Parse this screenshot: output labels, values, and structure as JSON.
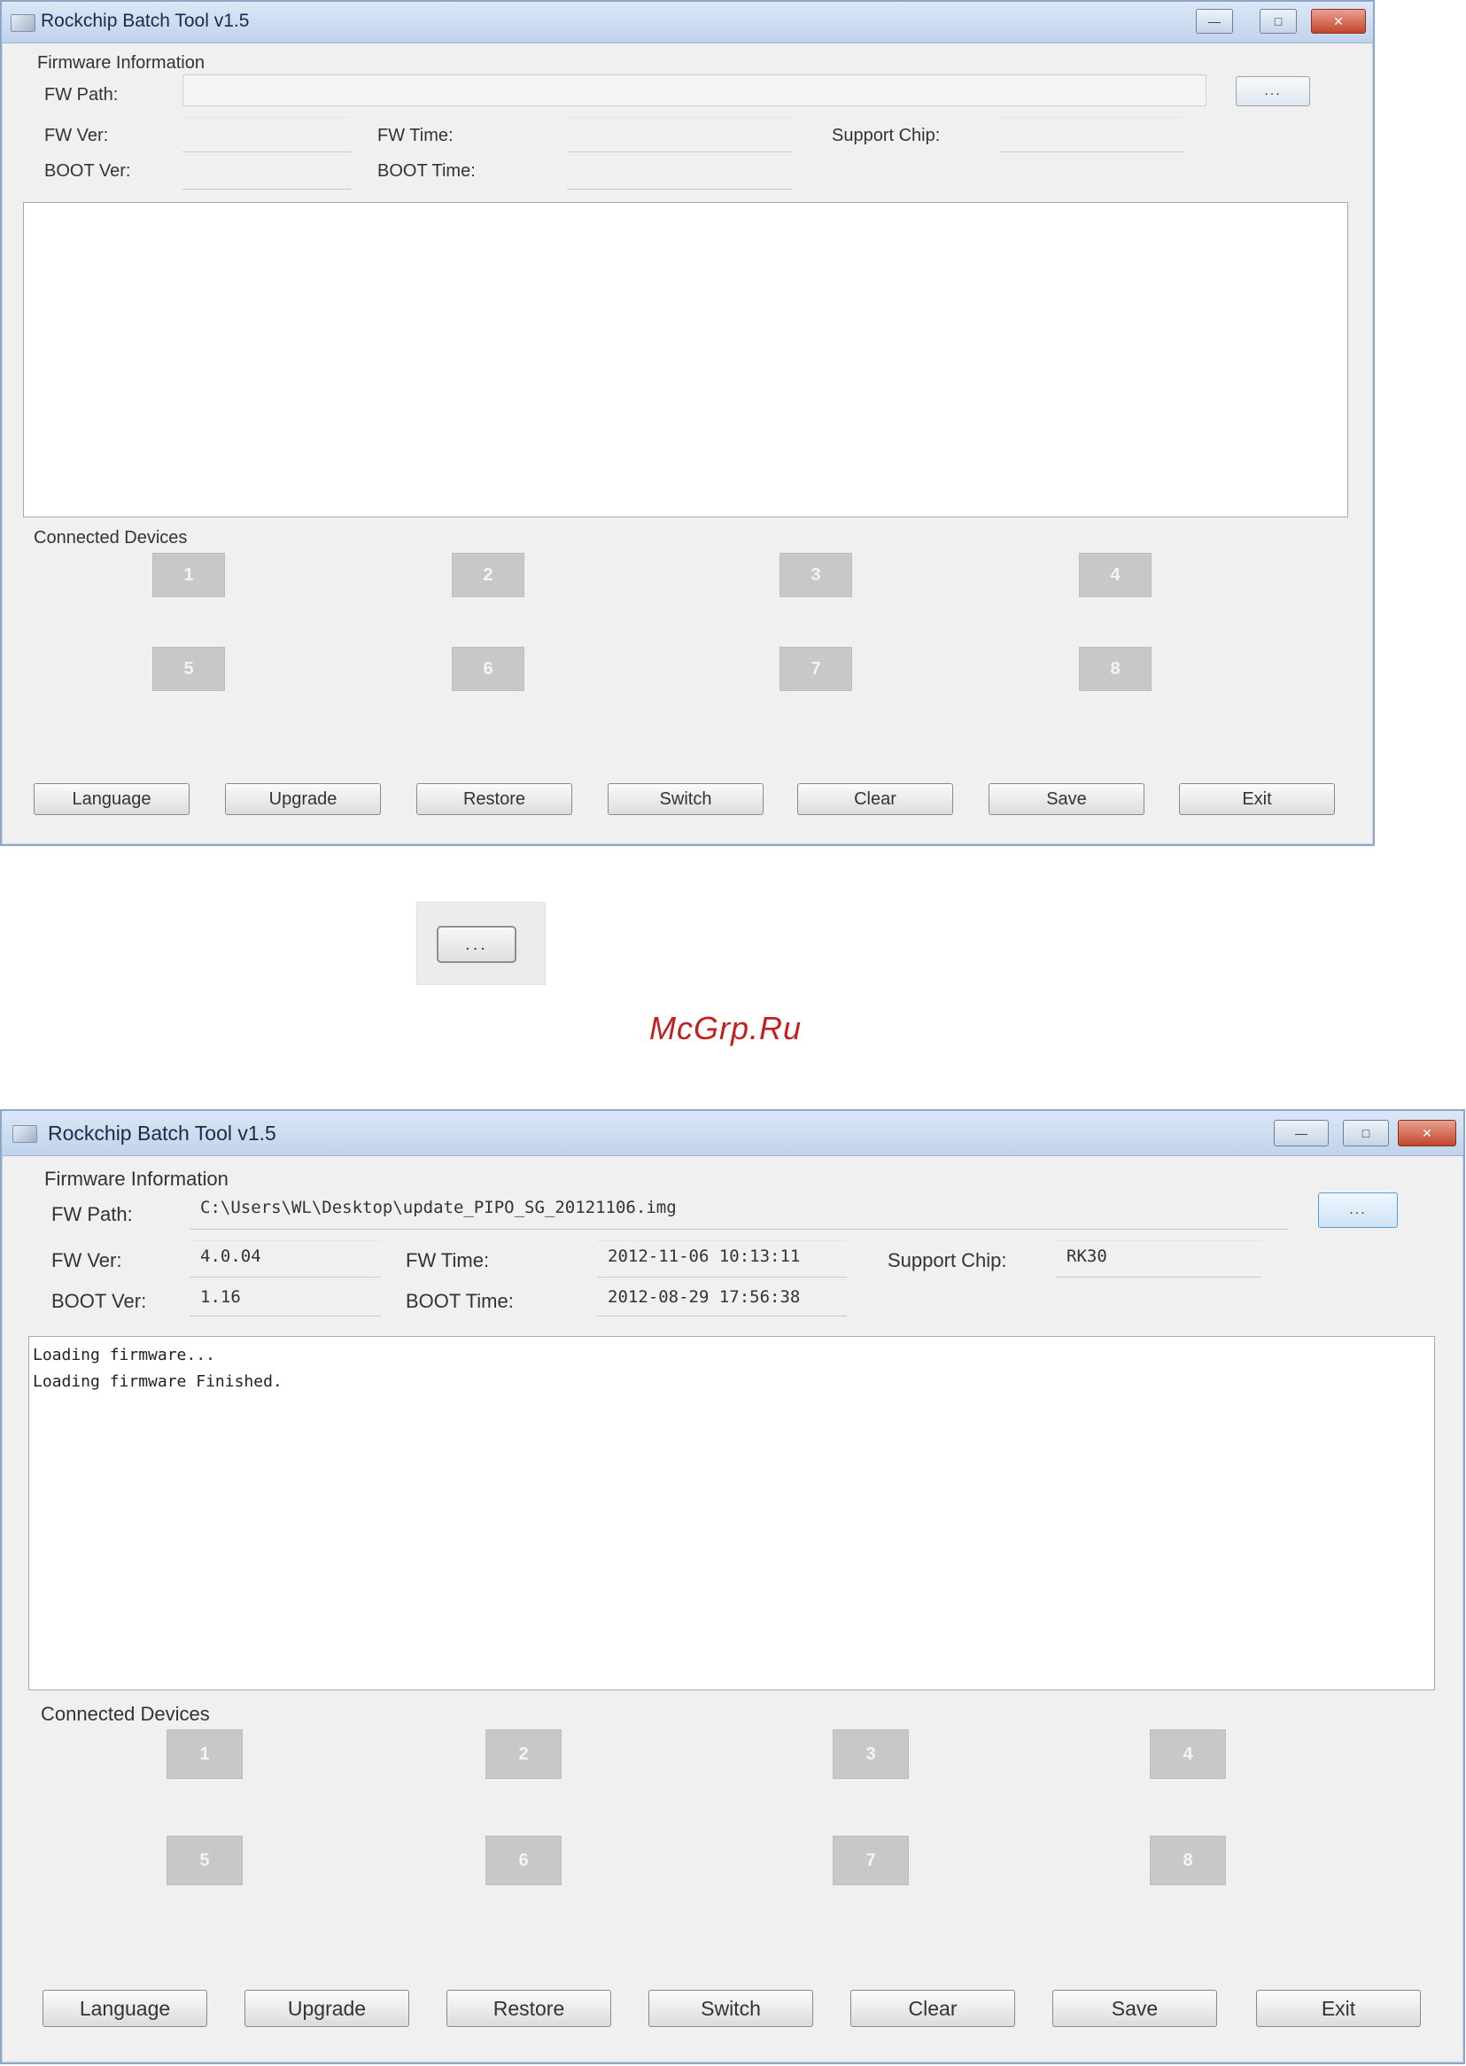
{
  "common": {
    "labels": {
      "firmware_information": "Firmware Information",
      "fw_path": "FW Path:",
      "fw_ver": "FW Ver:",
      "fw_time": "FW Time:",
      "support_chip": "Support Chip:",
      "boot_ver": "BOOT Ver:",
      "boot_time": "BOOT Time:",
      "connected_devices": "Connected Devices",
      "browse": "..."
    },
    "devices": [
      "1",
      "2",
      "3",
      "4",
      "5",
      "6",
      "7",
      "8"
    ],
    "buttons": {
      "language": "Language",
      "upgrade": "Upgrade",
      "restore": "Restore",
      "switch": "Switch",
      "clear": "Clear",
      "save": "Save",
      "exit": "Exit"
    },
    "window_controls": {
      "minimize": "—",
      "maximize": "□",
      "close": "✕"
    },
    "icon": "app-icon"
  },
  "window1": {
    "title": "Rockchip Batch Tool v1.5",
    "fields": {
      "fw_path": "",
      "fw_ver": "",
      "fw_time": "",
      "support_chip": "",
      "boot_ver": "",
      "boot_time": ""
    },
    "log": []
  },
  "zoom": {
    "button_label": "..."
  },
  "watermark": "McGrp.Ru",
  "window2": {
    "title": "Rockchip Batch Tool v1.5",
    "fields": {
      "fw_path": "C:\\Users\\WL\\Desktop\\update_PIPO_SG_20121106.img",
      "fw_ver": "4.0.04",
      "fw_time": "2012-11-06 10:13:11",
      "support_chip": "RK30",
      "boot_ver": "1.16",
      "boot_time": "2012-08-29 17:56:38"
    },
    "log": [
      "Loading firmware...",
      "Loading firmware Finished."
    ]
  }
}
